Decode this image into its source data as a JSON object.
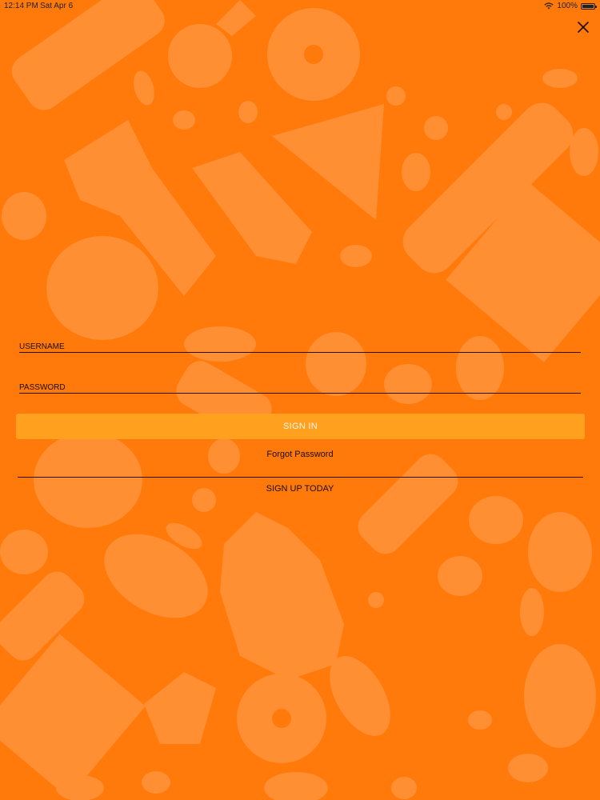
{
  "status_bar": {
    "time": "12:14 PM",
    "date": "Sat Apr 6",
    "battery": "100%",
    "wifi_icon": "wifi-icon",
    "battery_icon": "battery-icon"
  },
  "colors": {
    "background": "#ff7a0a",
    "pattern": "#ff8f32",
    "button": "#ffa11e",
    "text": "#1a0d00"
  },
  "close_icon": "close-icon",
  "form": {
    "username_placeholder": "USERNAME",
    "username_value": "",
    "password_placeholder": "PASSWORD",
    "password_value": "",
    "sign_in_label": "SIGN IN",
    "forgot_password_label": "Forgot Password",
    "sign_up_label": "SIGN UP TODAY"
  }
}
